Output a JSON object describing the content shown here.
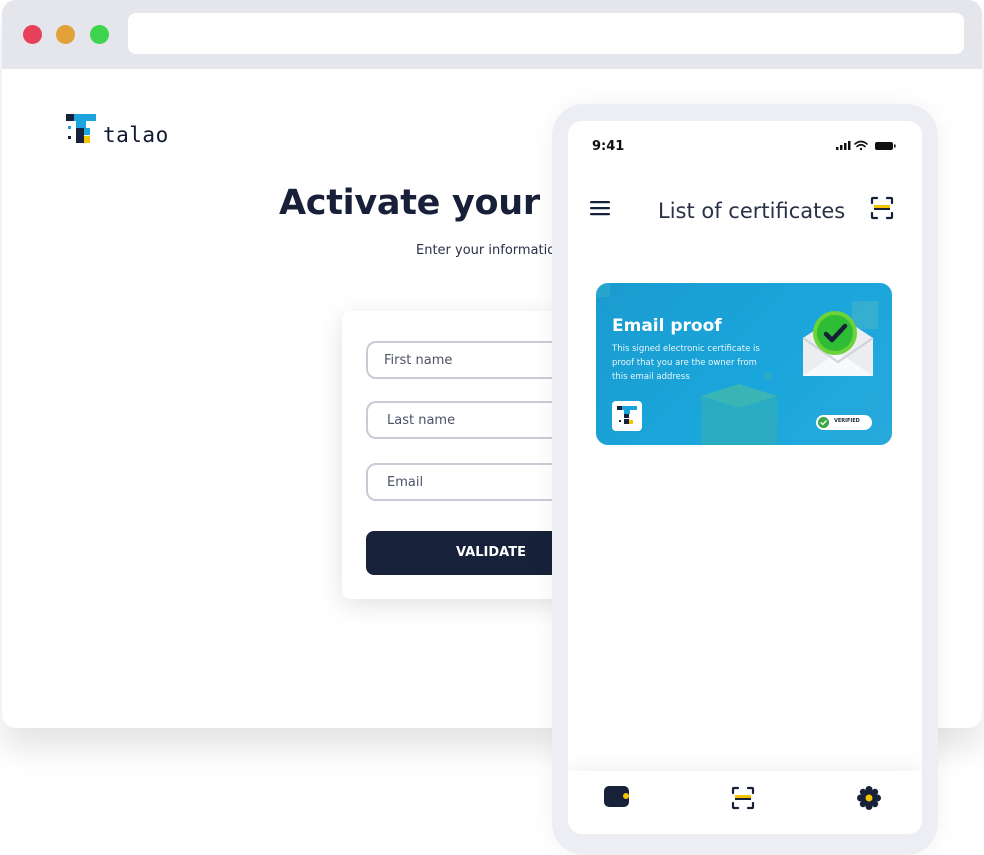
{
  "browser": {
    "logo_text": "talao",
    "heading": "Activate your en",
    "subheading": "Enter your information",
    "form": {
      "first_name_placeholder": "First name",
      "last_name_placeholder": "Last name",
      "email_placeholder": "Email",
      "validate_label": "VALIDATE"
    }
  },
  "phone": {
    "status_time": "9:41",
    "app_title": "List of certificates",
    "certificate": {
      "title": "Email proof",
      "description": "This signed electronic certificate is proof that you are the owner from this email address",
      "badge": "VERIFIED"
    },
    "nav": {
      "items": [
        "wallet-icon",
        "scan-icon",
        "settings-icon"
      ]
    }
  },
  "colors": {
    "navy": "#172139",
    "card_blue": "#1aa6db",
    "accent_yellow": "#f5c400",
    "success_green": "#3aa748"
  }
}
